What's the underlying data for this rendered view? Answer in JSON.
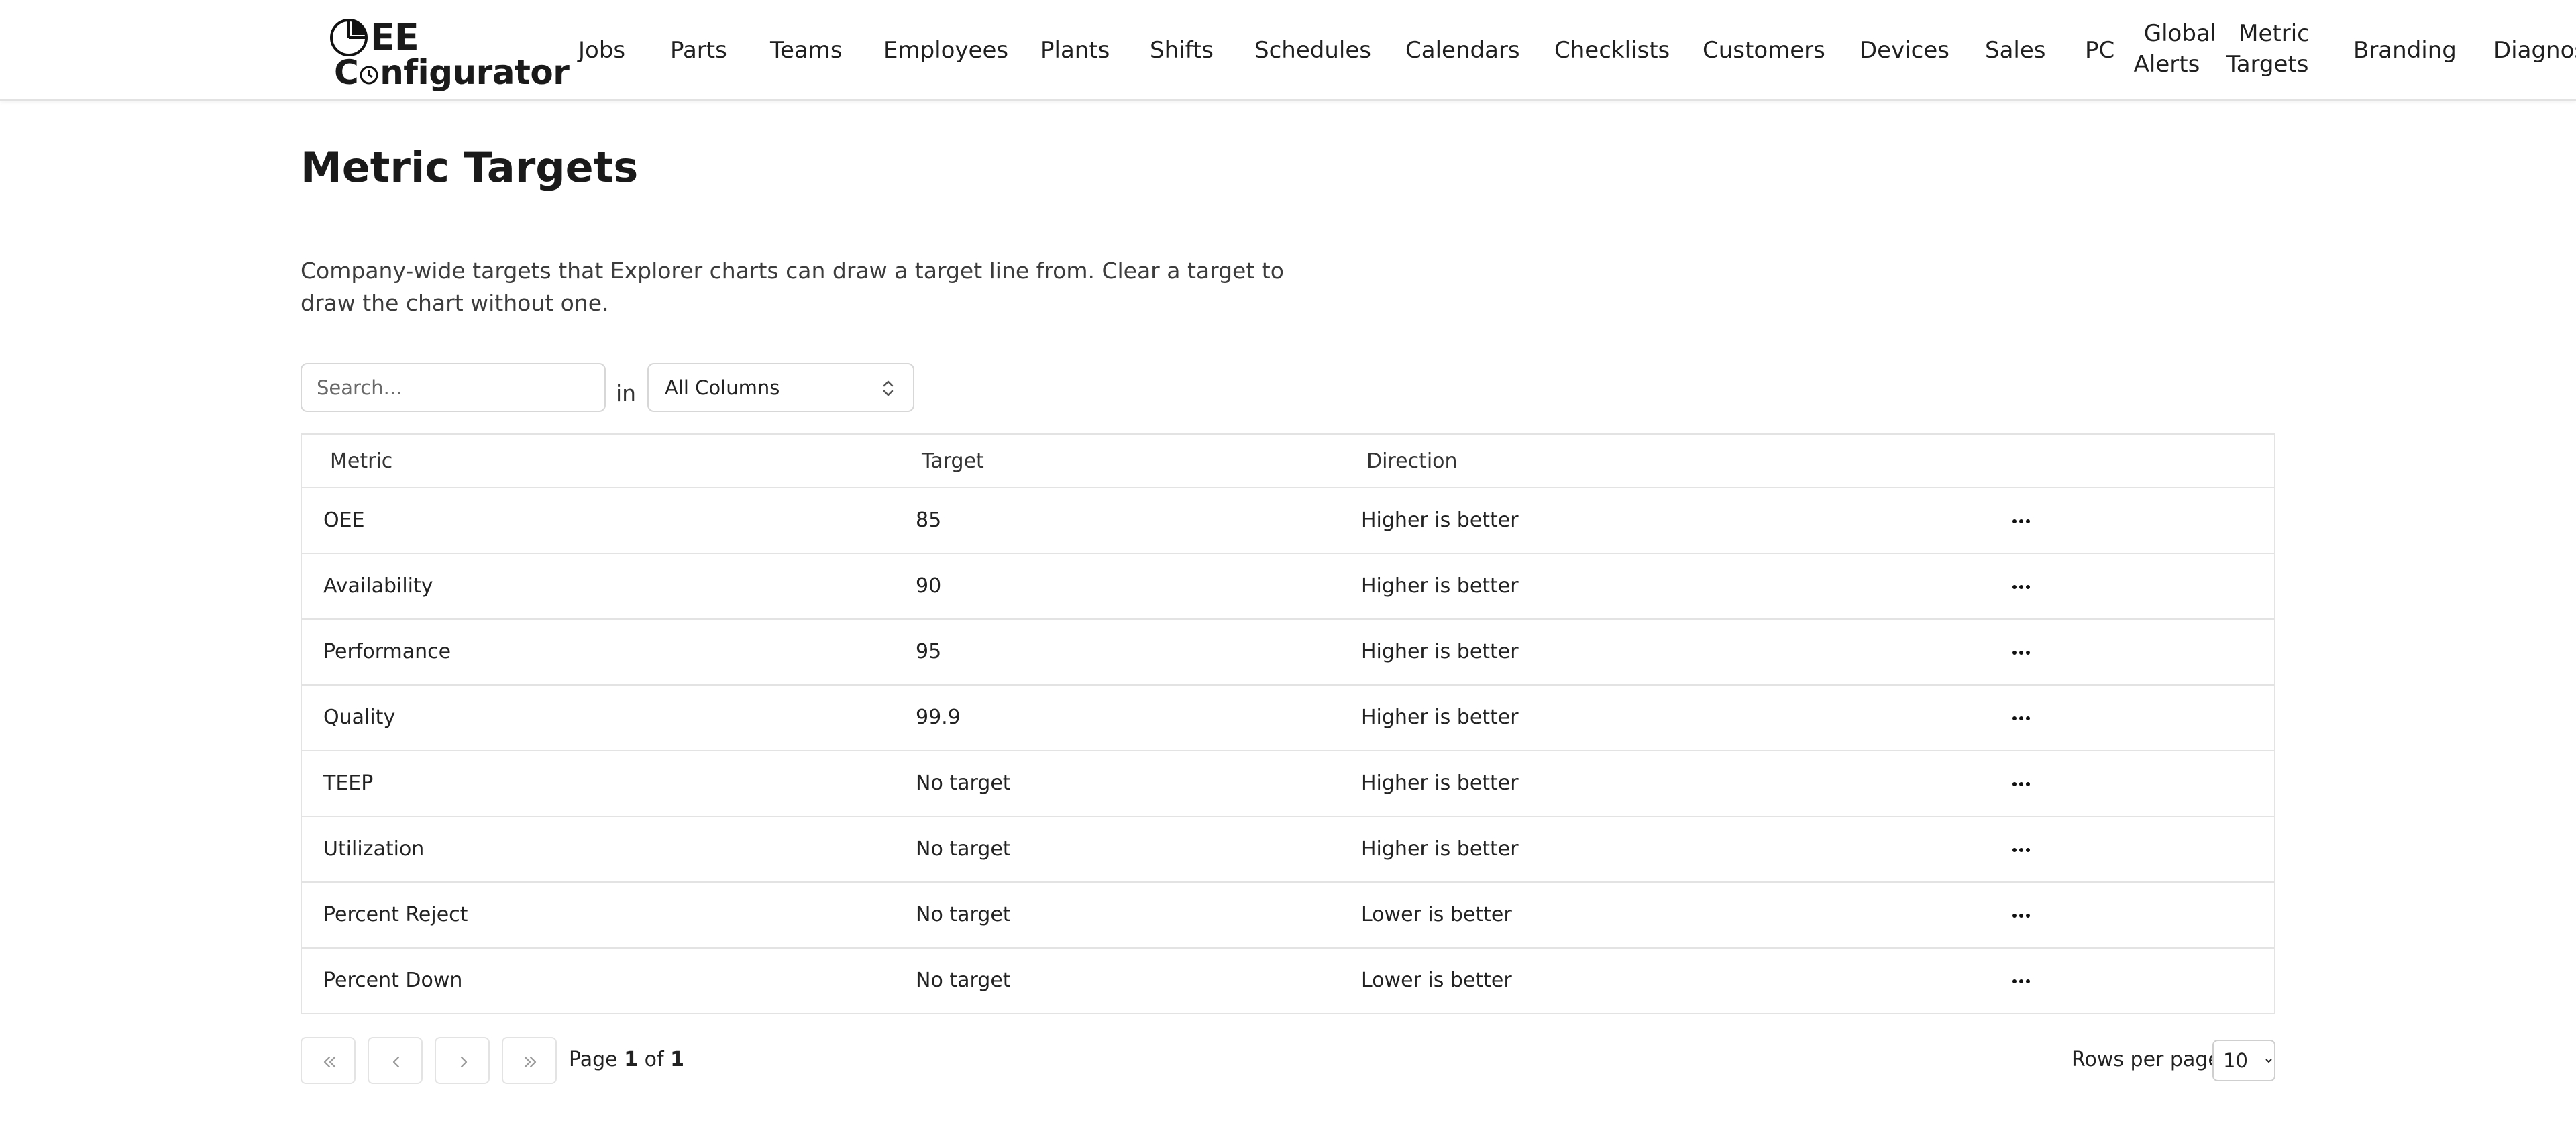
{
  "logo": {
    "line1": "EE",
    "line2_a": "C",
    "line2_b": "nfigurator"
  },
  "nav": {
    "jobs": "Jobs",
    "parts": "Parts",
    "teams": "Teams",
    "employees": "Employees",
    "plants": "Plants",
    "shifts": "Shifts",
    "schedules": "Schedules",
    "calendars": "Calendars",
    "checklists": "Checklists",
    "customers": "Customers",
    "devices": "Devices",
    "sales": "Sales",
    "pc": "PC",
    "global_alerts_1": "Global",
    "global_alerts_2": "Alerts",
    "metric_targets_1": "Metric",
    "metric_targets_2": "Targets",
    "branding": "Branding",
    "diagnostics": "Diagnos"
  },
  "page": {
    "title": "Metric Targets",
    "description": "Company-wide targets that Explorer charts can draw a target line from. Clear a target to draw the chart without one."
  },
  "filter": {
    "search_placeholder": "Search...",
    "in_label": "in",
    "column_value": "All Columns"
  },
  "table": {
    "headers": {
      "metric": "Metric",
      "target": "Target",
      "direction": "Direction"
    },
    "rows": [
      {
        "metric": "OEE",
        "target": "85",
        "direction": "Higher is better"
      },
      {
        "metric": "Availability",
        "target": "90",
        "direction": "Higher is better"
      },
      {
        "metric": "Performance",
        "target": "95",
        "direction": "Higher is better"
      },
      {
        "metric": "Quality",
        "target": "99.9",
        "direction": "Higher is better"
      },
      {
        "metric": "TEEP",
        "target": "No target",
        "direction": "Higher is better"
      },
      {
        "metric": "Utilization",
        "target": "No target",
        "direction": "Higher is better"
      },
      {
        "metric": "Percent Reject",
        "target": "No target",
        "direction": "Lower is better"
      },
      {
        "metric": "Percent Down",
        "target": "No target",
        "direction": "Lower is better"
      }
    ]
  },
  "pagination": {
    "page_prefix": "Page",
    "current": "1",
    "of": "of",
    "total": "1",
    "rows_per_page_label": "Rows per page",
    "rows_per_page_value": "10"
  },
  "icons": {
    "logo": "pie-chart-icon",
    "logo_o": "clock-icon",
    "select": "chevron-up-down-icon",
    "row_menu": "ellipsis-icon",
    "first": "chevrons-left-icon",
    "prev": "chevron-left-icon",
    "next": "chevron-right-icon",
    "last": "chevrons-right-icon"
  }
}
